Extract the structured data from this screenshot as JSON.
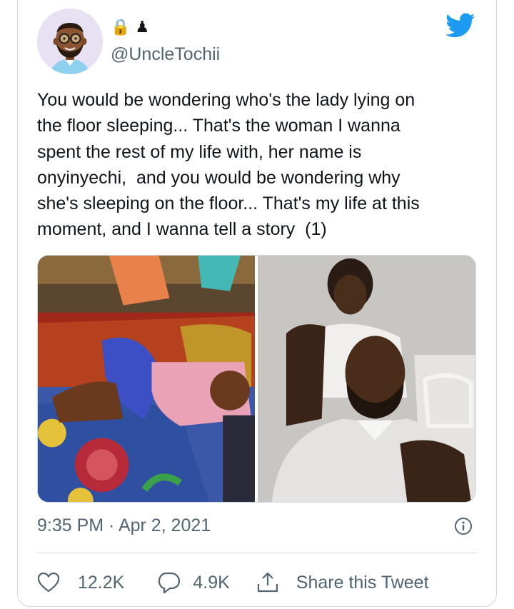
{
  "user": {
    "display_name": "🔒 ♟",
    "handle": "@UncleTochii"
  },
  "tweet": {
    "text": "You would be wondering who's the lady lying on\nthe floor sleeping... That's the woman I wanna\nspent the rest of my life with, her name is\nonyinyechi,  and you would be wondering why\nshe's sleeping on the floor... That's my life at this\nmoment, and I wanna tell a story  (1)",
    "timestamp": "9:35 PM · Apr 2, 2021"
  },
  "actions": {
    "likes": "12.2K",
    "replies": "4.9K",
    "share_label": "Share this Tweet"
  },
  "colors": {
    "twitter_blue": "#1d9bf0",
    "secondary_text": "#536471",
    "border": "#cfd9de"
  },
  "icons": [
    "lock-icon",
    "chess-pawn-icon",
    "twitter-bird-icon",
    "info-icon",
    "heart-icon",
    "reply-icon",
    "share-icon"
  ]
}
